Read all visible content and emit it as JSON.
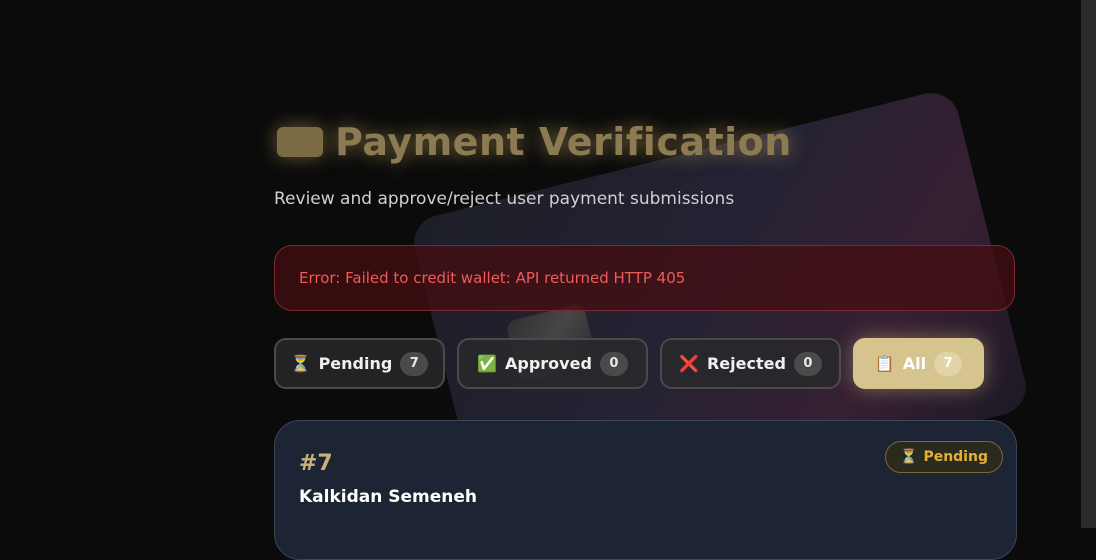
{
  "header": {
    "title": "Payment Verification",
    "subtitle": "Review and approve/reject user payment submissions"
  },
  "error": {
    "message": "Error: Failed to credit wallet: API returned HTTP 405"
  },
  "filters": [
    {
      "icon": "⏳",
      "icon_name": "hourglass-icon",
      "label": "Pending",
      "count": "7",
      "active": false
    },
    {
      "icon": "✅",
      "icon_name": "check-icon",
      "label": "Approved",
      "count": "0",
      "active": false
    },
    {
      "icon": "❌",
      "icon_name": "cross-icon",
      "label": "Rejected",
      "count": "0",
      "active": false
    },
    {
      "icon": "📋",
      "icon_name": "clipboard-icon",
      "label": "All",
      "count": "7",
      "active": true
    }
  ],
  "payments": [
    {
      "id": "#7",
      "name": "Kalkidan Semeneh",
      "status": "Pending",
      "status_icon": "⏳"
    }
  ],
  "colors": {
    "accent": "#d6c48e",
    "error": "#ef5a5a",
    "pending": "#e8b030"
  }
}
